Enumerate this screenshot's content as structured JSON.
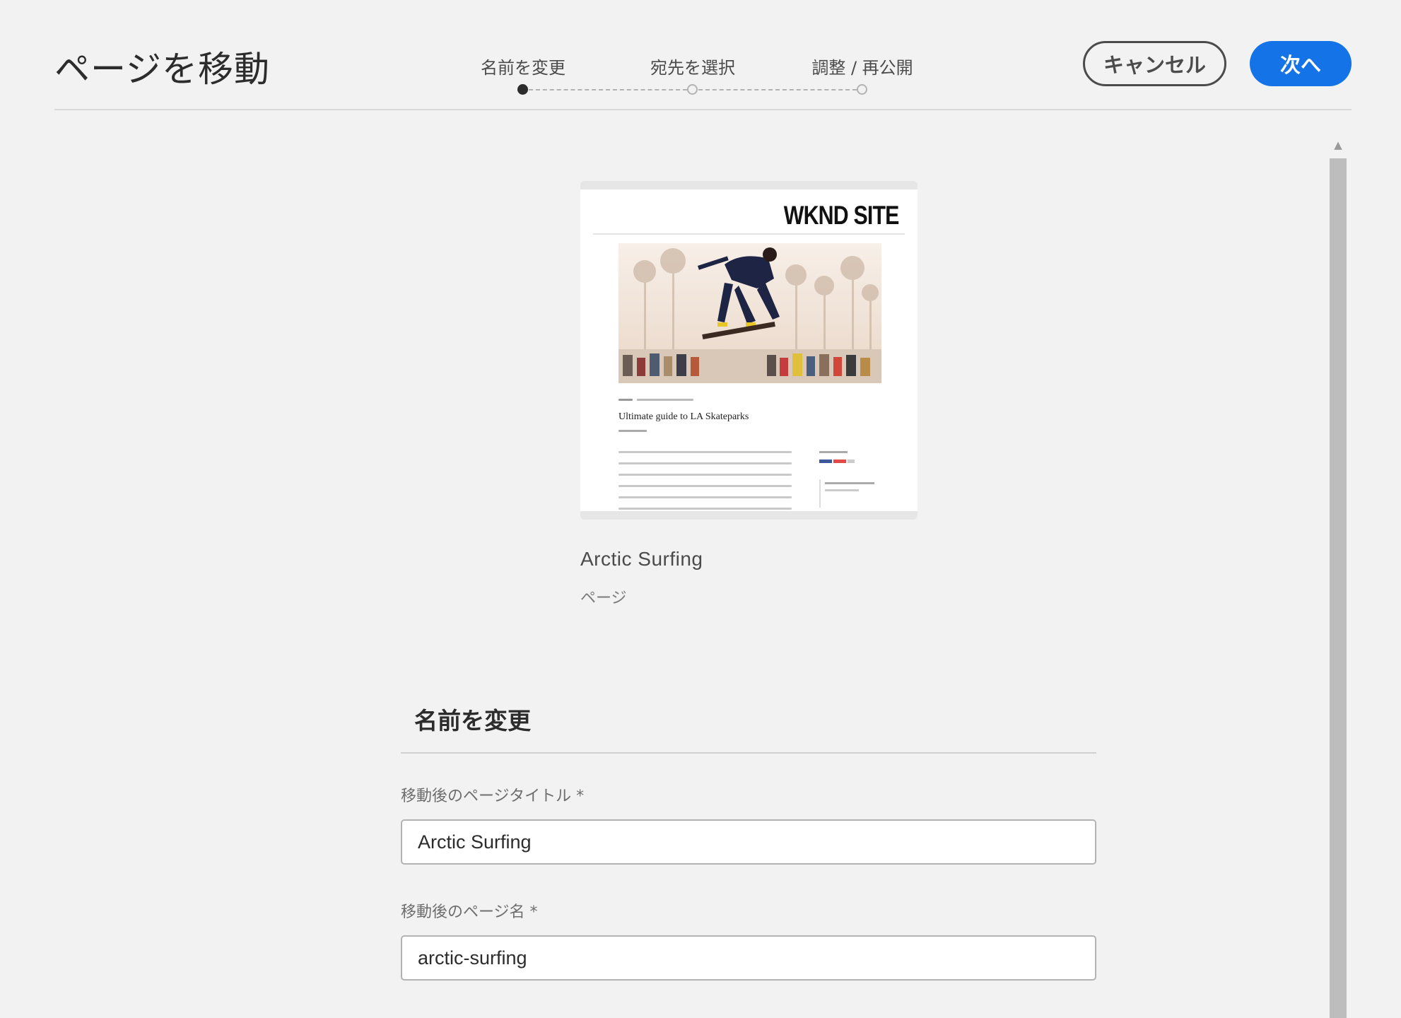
{
  "header": {
    "title": "ページを移動",
    "cancel_label": "キャンセル",
    "next_label": "次へ"
  },
  "stepper": {
    "steps": [
      {
        "label": "名前を変更",
        "state": "active"
      },
      {
        "label": "宛先を選択",
        "state": "pending"
      },
      {
        "label": "調整 / 再公開",
        "state": "pending"
      }
    ],
    "current_step": 1
  },
  "preview": {
    "thumbnail": {
      "site_logo": "WKND SITE",
      "article_title": "Ultimate guide to LA Skateparks"
    },
    "page_name": "Arctic Surfing",
    "page_type": "ページ"
  },
  "form": {
    "section_title": "名前を変更",
    "fields": [
      {
        "label": "移動後のページタイトル *",
        "value": "Arctic Surfing"
      },
      {
        "label": "移動後のページ名 *",
        "value": "arctic-surfing"
      }
    ]
  },
  "colors": {
    "accent": "#1473e6",
    "background": "#f2f2f2"
  }
}
